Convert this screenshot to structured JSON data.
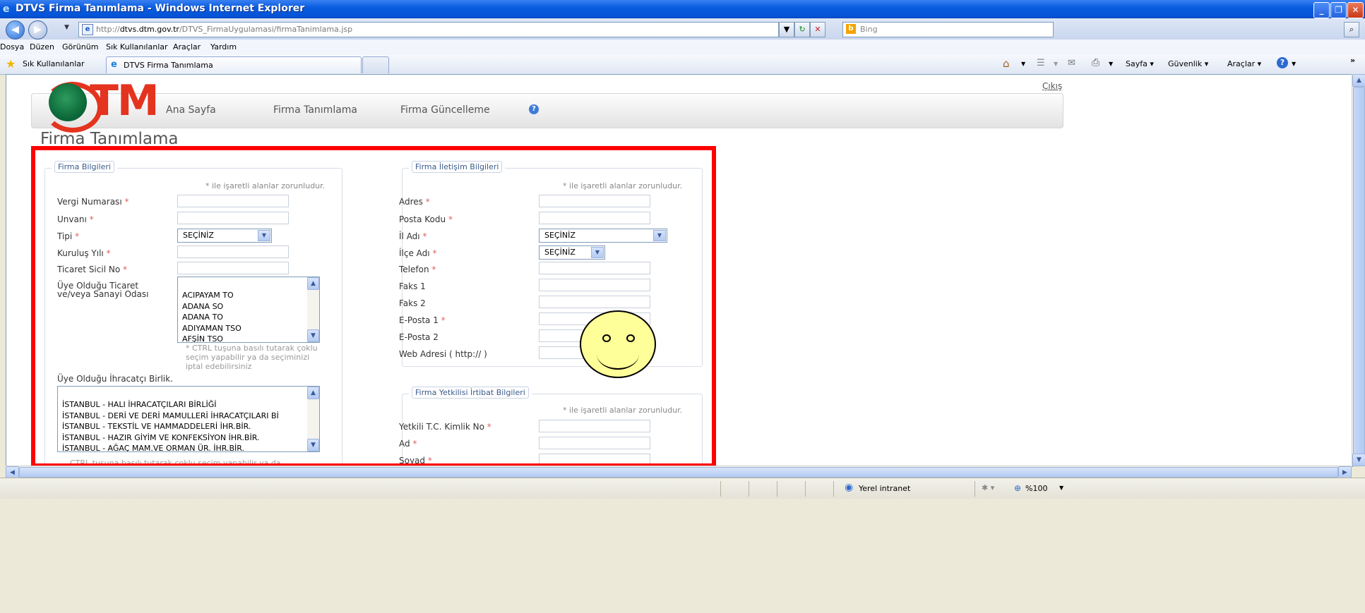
{
  "window": {
    "title": "DTVS Firma Tanımlama - Windows Internet Explorer",
    "url_prefix": "http://",
    "url_domain": "dtvs.dtm.gov.tr",
    "url_path": "/DTVS_FirmaUygulamasi/firmaTanimlama.jsp",
    "search_placeholder": "Bing"
  },
  "menu": [
    "Dosya",
    "Düzen",
    "Görünüm",
    "Sık Kullanılanlar",
    "Araçlar",
    "Yardım"
  ],
  "favorites": {
    "label": "Sık Kullanılanlar",
    "tab_title": "DTVS Firma Tanımlama",
    "commands": [
      "Sayfa",
      "Güvenlik",
      "Araçlar"
    ]
  },
  "page": {
    "logout": "Çıkış",
    "logo": "TM",
    "nav": [
      "Ana Sayfa",
      "Firma Tanımlama",
      "Firma Güncelleme"
    ],
    "title": "Firma Tanımlama",
    "required_note": "* ile işaretli alanlar zorunludur.",
    "firm_info": {
      "legend": "Firma Bilgileri",
      "fields": [
        "Vergi Numarası",
        "Unvanı",
        "Tipi",
        "Kuruluş Yılı",
        "Ticaret Sicil No"
      ],
      "tipi_value": "SEÇİNİZ",
      "chamber_label_1": "Üye Olduğu Ticaret",
      "chamber_label_2": "ve/veya Sanayi Odası",
      "chambers": [
        "ACIPAYAM TO",
        "ADANA SO",
        "ADANA TO",
        "ADIYAMAN TSO",
        "AFŞİN TSO"
      ],
      "ctrl_hint": "* CTRL tuşuna basılı tutarak çoklu seçim yapabilir ya da seçiminizi iptal edebilirsiniz",
      "exporter_label": "Üye Olduğu İhracatçı Birlik.",
      "exporters": [
        "İSTANBUL - HALI İHRACATÇILARI BİRLİĞİ",
        "İSTANBUL - DERİ VE DERİ MAMULLERİ İHRACATÇILARI Bİ",
        "İSTANBUL - TEKSTİL VE HAMMADDELERİ İHR.BİR.",
        "İSTANBUL - HAZIR GİYİM VE KONFEKSİYON İHR.BİR.",
        "İSTANBUL - AĞAÇ MAM.VE ORMAN ÜR. İHR.BİR."
      ],
      "exporter_hint": "CTRL tuşuna basılı tutarak çoklu seçim yapabilir ya da"
    },
    "contact_info": {
      "legend": "Firma İletişim Bilgileri",
      "fields": [
        "Adres",
        "Posta Kodu",
        "İl Adı",
        "İlçe Adı",
        "Telefon",
        "Faks 1",
        "Faks 2",
        "E-Posta 1",
        "E-Posta 2",
        "Web Adresi ( http:// )"
      ],
      "il_value": "SEÇİNİZ",
      "ilce_value": "SEÇİNİZ"
    },
    "contact_person": {
      "legend": "Firma Yetkilisi İrtibat Bilgileri",
      "fields": [
        "Yetkili T.C. Kimlik No",
        "Ad",
        "Soyad"
      ]
    }
  },
  "status": {
    "zone": "Yerel intranet",
    "zoom": "%100"
  }
}
